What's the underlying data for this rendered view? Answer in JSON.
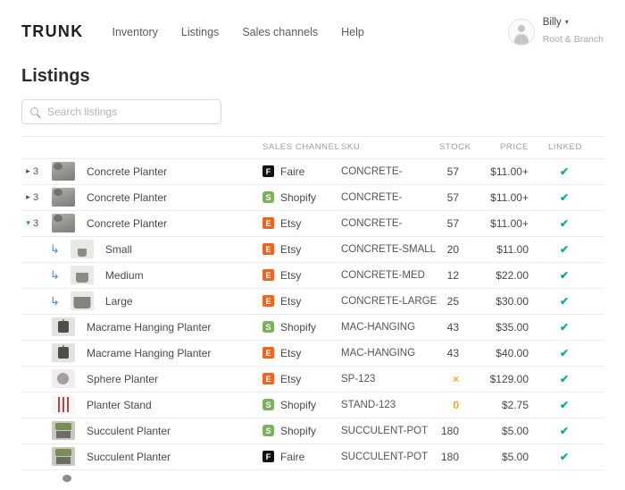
{
  "brand": {
    "logo": "Trunk"
  },
  "nav": [
    "Inventory",
    "Listings",
    "Sales channels",
    "Help"
  ],
  "user": {
    "name": "Billy",
    "org": "Root & Branch"
  },
  "page": {
    "title": "Listings"
  },
  "search": {
    "placeholder": "Search listings"
  },
  "icons": {
    "check": "✔",
    "collapsed_caret": "▸",
    "expanded_caret": "▾",
    "child_arrow": "↳",
    "user_caret": "▾"
  },
  "colors": {
    "accent_teal": "#0caa9b",
    "warning_orange": "#f5a623",
    "etsy_orange": "#f1641e",
    "shopify_green": "#79b259",
    "faire_black": "#111111",
    "child_arrow_blue": "#4a90d9"
  },
  "table": {
    "headers": [
      "SALES CHANNEL",
      "SKU",
      "STOCK",
      "PRICE",
      "LINKED"
    ],
    "rows": [
      {
        "expand": "collapsed",
        "count": "3",
        "child": false,
        "thumb": "concrete",
        "name": "Concrete Planter",
        "channel": {
          "label": "Faire",
          "initial": "F",
          "type": "faire"
        },
        "sku": "CONCRETE-",
        "stock": "57",
        "stock_state": "ok",
        "price": "$11.00+",
        "linked": true
      },
      {
        "expand": "collapsed",
        "count": "3",
        "child": false,
        "thumb": "concrete",
        "name": "Concrete Planter",
        "channel": {
          "label": "Shopify",
          "initial": "S",
          "type": "shopify"
        },
        "sku": "CONCRETE-",
        "stock": "57",
        "stock_state": "ok",
        "price": "$11.00+",
        "linked": true
      },
      {
        "expand": "expanded",
        "count": "3",
        "child": false,
        "thumb": "concrete",
        "name": "Concrete Planter",
        "channel": {
          "label": "Etsy",
          "initial": "E",
          "type": "etsy"
        },
        "sku": "CONCRETE-",
        "stock": "57",
        "stock_state": "ok",
        "price": "$11.00+",
        "linked": true
      },
      {
        "child": true,
        "thumb": "pot-small",
        "name": "Small",
        "channel": {
          "label": "Etsy",
          "initial": "E",
          "type": "etsy"
        },
        "sku": "CONCRETE-SMALL",
        "stock": "20",
        "stock_state": "ok",
        "price": "$11.00",
        "linked": true
      },
      {
        "child": true,
        "thumb": "pot-medium",
        "name": "Medium",
        "channel": {
          "label": "Etsy",
          "initial": "E",
          "type": "etsy"
        },
        "sku": "CONCRETE-MED",
        "stock": "12",
        "stock_state": "ok",
        "price": "$22.00",
        "linked": true
      },
      {
        "child": true,
        "thumb": "pot-large",
        "name": "Large",
        "channel": {
          "label": "Etsy",
          "initial": "E",
          "type": "etsy"
        },
        "sku": "CONCRETE-LARGE",
        "stock": "25",
        "stock_state": "ok",
        "price": "$30.00",
        "linked": true
      },
      {
        "child": false,
        "thumb": "macrame",
        "name": "Macrame Hanging Planter",
        "channel": {
          "label": "Shopify",
          "initial": "S",
          "type": "shopify"
        },
        "sku": "MAC-HANGING",
        "stock": "43",
        "stock_state": "ok",
        "price": "$35.00",
        "linked": true
      },
      {
        "child": false,
        "thumb": "macrame",
        "name": "Macrame Hanging Planter",
        "channel": {
          "label": "Etsy",
          "initial": "E",
          "type": "etsy"
        },
        "sku": "MAC-HANGING",
        "stock": "43",
        "stock_state": "ok",
        "price": "$40.00",
        "linked": true
      },
      {
        "child": false,
        "thumb": "sphere",
        "name": "Sphere Planter",
        "channel": {
          "label": "Etsy",
          "initial": "E",
          "type": "etsy"
        },
        "sku": "SP-123",
        "stock": "×",
        "stock_state": "warn",
        "price": "$129.00",
        "linked": true
      },
      {
        "child": false,
        "thumb": "stand",
        "name": "Planter Stand",
        "channel": {
          "label": "Shopify",
          "initial": "S",
          "type": "shopify"
        },
        "sku": "STAND-123",
        "stock": "0",
        "stock_state": "warn",
        "price": "$2.75",
        "linked": true
      },
      {
        "child": false,
        "thumb": "succulent",
        "name": "Succulent Planter",
        "channel": {
          "label": "Shopify",
          "initial": "S",
          "type": "shopify"
        },
        "sku": "SUCCULENT-POT",
        "stock": "180",
        "stock_state": "ok",
        "price": "$5.00",
        "linked": true
      },
      {
        "child": false,
        "thumb": "succulent",
        "name": "Succulent Planter",
        "channel": {
          "label": "Faire",
          "initial": "F",
          "type": "faire"
        },
        "sku": "SUCCULENT-POT",
        "stock": "180",
        "stock_state": "ok",
        "price": "$5.00",
        "linked": true
      }
    ]
  }
}
